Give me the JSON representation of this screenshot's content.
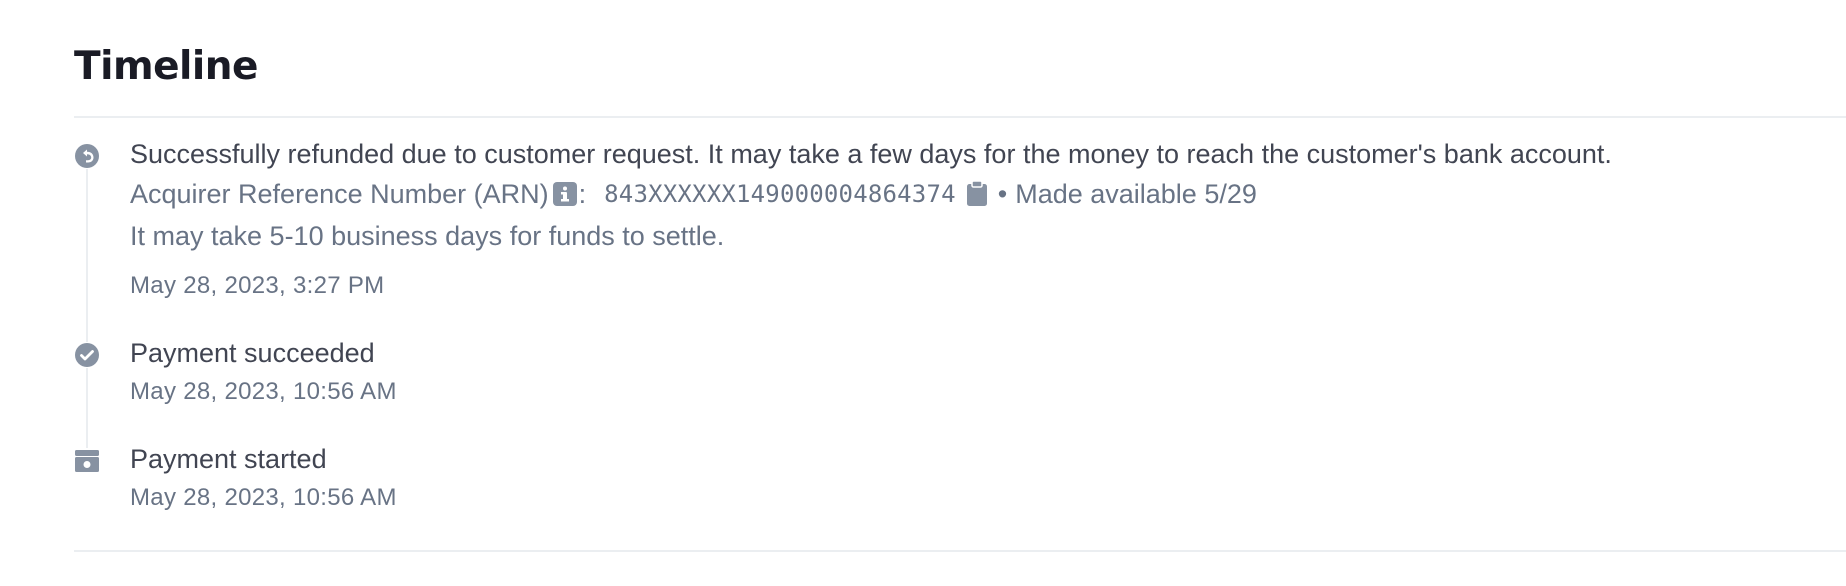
{
  "section": {
    "title": "Timeline"
  },
  "timeline": {
    "events": [
      {
        "icon": "refund-icon",
        "message": "Successfully refunded due to customer request. It may take a few days for the money to reach the customer's bank account.",
        "arn_label": "Acquirer Reference Number (ARN)",
        "arn_colon": ":",
        "arn_value": "843XXXXXX149000004864374",
        "separator": "•",
        "availability": "Made available 5/29",
        "note": "It may take 5-10 business days for funds to settle.",
        "timestamp": "May 28, 2023, 3:27 PM"
      },
      {
        "icon": "check-circle-icon",
        "message": "Payment succeeded",
        "timestamp": "May 28, 2023, 10:56 AM"
      },
      {
        "icon": "payment-card-icon",
        "message": "Payment started",
        "timestamp": "May 28, 2023, 10:56 AM"
      }
    ]
  },
  "colors": {
    "icon_gray": "#8792a2",
    "primary_text": "#414552",
    "secondary_text": "#687385",
    "divider": "#ebeef1"
  }
}
